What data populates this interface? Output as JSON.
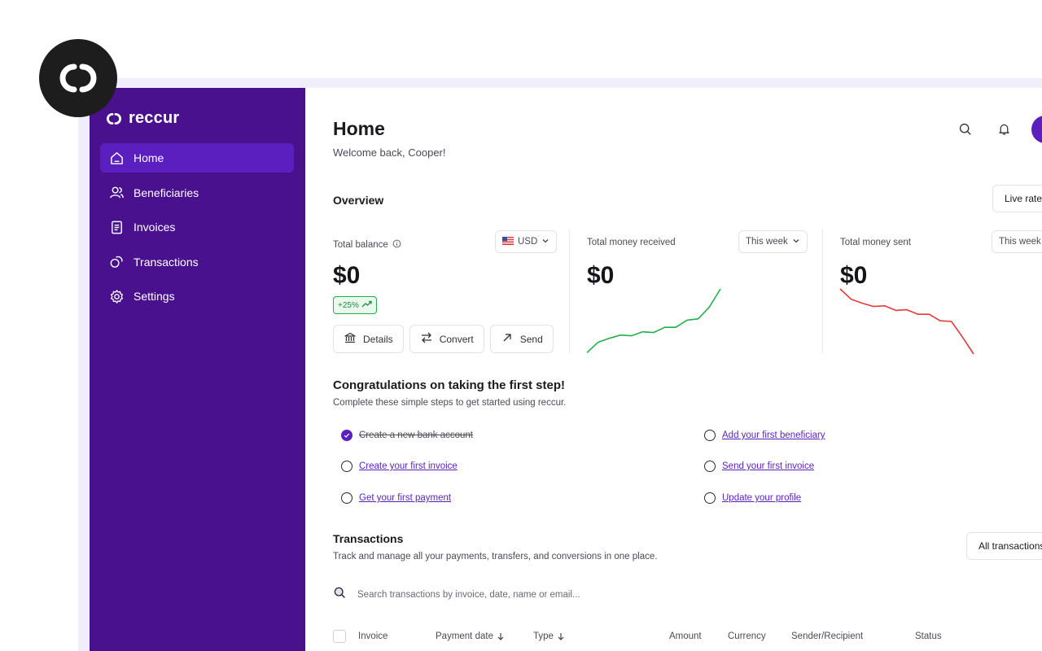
{
  "brand": {
    "name": "reccur"
  },
  "sidebar": {
    "items": [
      {
        "label": "Home",
        "icon": "home-icon",
        "active": true
      },
      {
        "label": "Beneficiaries",
        "icon": "users-icon",
        "active": false
      },
      {
        "label": "Invoices",
        "icon": "invoice-icon",
        "active": false
      },
      {
        "label": "Transactions",
        "icon": "transactions-icon",
        "active": false
      },
      {
        "label": "Settings",
        "icon": "gear-icon",
        "active": false
      }
    ]
  },
  "header": {
    "title": "Home",
    "welcome": "Welcome back, Cooper!"
  },
  "overview": {
    "title": "Overview",
    "live_rates": "Live rates",
    "balance": {
      "label": "Total balance",
      "currency": "USD",
      "amount": "$0",
      "growth": "+25%",
      "actions": [
        "Details",
        "Convert",
        "Send"
      ]
    },
    "received": {
      "label": "Total money received",
      "period": "This week",
      "amount": "$0",
      "trend": [
        0.02,
        0.18,
        0.24,
        0.29,
        0.28,
        0.34,
        0.33,
        0.41,
        0.41,
        0.52,
        0.54,
        0.72,
        1.0
      ]
    },
    "sent": {
      "label": "Total money sent",
      "period": "This week",
      "amount": "$0",
      "trend": [
        1.0,
        0.84,
        0.78,
        0.73,
        0.74,
        0.67,
        0.68,
        0.61,
        0.61,
        0.51,
        0.5,
        0.26,
        0.0
      ]
    }
  },
  "steps": {
    "title": "Congratulations on taking the first step!",
    "subtitle": "Complete these simple steps to get started using reccur.",
    "items": [
      {
        "label": "Create a new bank account",
        "done": true
      },
      {
        "label": "Add your first beneficiary",
        "done": false
      },
      {
        "label": "Create your first invoice",
        "done": false
      },
      {
        "label": "Send your first invoice",
        "done": false
      },
      {
        "label": "Get your first payment",
        "done": false
      },
      {
        "label": "Update your profile",
        "done": false
      }
    ]
  },
  "transactions": {
    "title": "Transactions",
    "subtitle": "Track and manage all your payments, transfers, and conversions in one place.",
    "filter": "All transactions",
    "search_placeholder": "Search transactions by invoice, date, name or email...",
    "columns": [
      "Invoice",
      "Payment date",
      "Type",
      "Amount",
      "Currency",
      "Sender/Recipient",
      "Status"
    ]
  },
  "colors": {
    "sidebar": "#4a118f",
    "accent": "#5b1fbf",
    "positive": "#22b04b",
    "negative": "#e23b3b"
  }
}
